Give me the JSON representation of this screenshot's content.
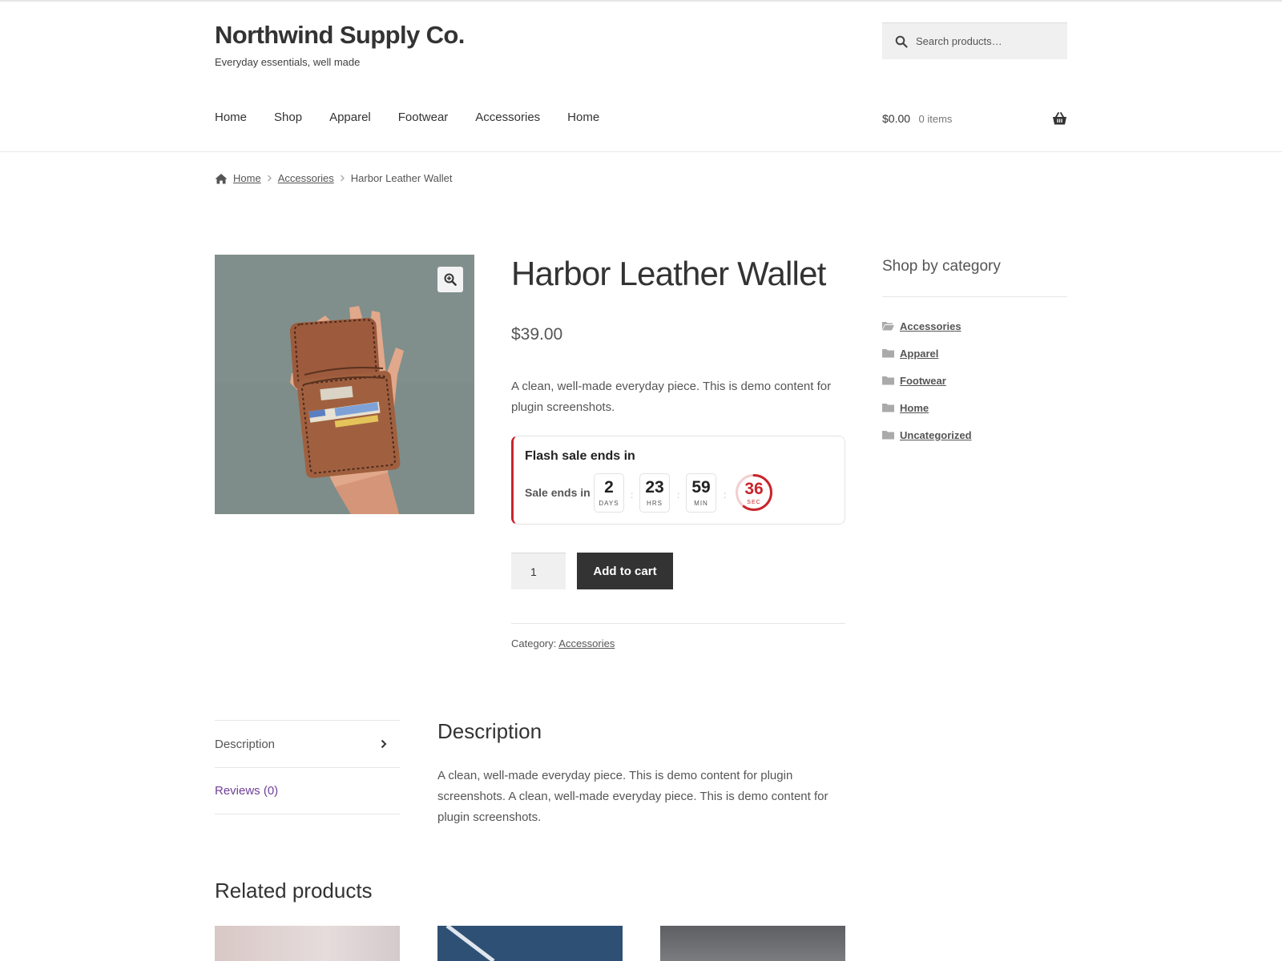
{
  "site": {
    "title": "Northwind Supply Co.",
    "tagline": "Everyday essentials, well made"
  },
  "search": {
    "placeholder": "Search products…",
    "icon": "search-icon"
  },
  "nav": {
    "items": [
      "Home",
      "Shop",
      "Apparel",
      "Footwear",
      "Accessories",
      "Home"
    ]
  },
  "cart": {
    "amount": "$0.00",
    "count": "0 items",
    "icon": "basket-icon"
  },
  "breadcrumb": {
    "home": "Home",
    "category": "Accessories",
    "current": "Harbor Leather Wallet"
  },
  "product": {
    "title": "Harbor Leather Wallet",
    "price": "$39.00",
    "short_description": "A clean, well-made everyday piece. This is demo content for plugin screenshots.",
    "quantity": "1",
    "add_to_cart": "Add to cart",
    "meta_label": "Category:",
    "meta_category": "Accessories"
  },
  "countdown": {
    "title": "Flash sale ends in",
    "label": "Sale ends in",
    "days": "2",
    "days_unit": "DAYS",
    "hours": "23",
    "hours_unit": "HRS",
    "minutes": "59",
    "minutes_unit": "MIN",
    "seconds": "36",
    "seconds_unit": "SEC",
    "seconds_progress": 0.6,
    "accent_color": "#c9252c"
  },
  "sidebar": {
    "title": "Shop by category",
    "categories": [
      "Accessories",
      "Apparel",
      "Footwear",
      "Home",
      "Uncategorized"
    ]
  },
  "tabs": {
    "items": [
      "Description",
      "Reviews (0)"
    ],
    "panel_title": "Description",
    "panel_text": "A clean, well-made everyday piece. This is demo content for plugin screenshots. A clean, well-made everyday piece. This is demo content for plugin screenshots."
  },
  "related": {
    "title": "Related products"
  },
  "colors": {
    "dark": "#333333",
    "link_purple": "#6e3f97",
    "accent_red": "#c9252c"
  }
}
